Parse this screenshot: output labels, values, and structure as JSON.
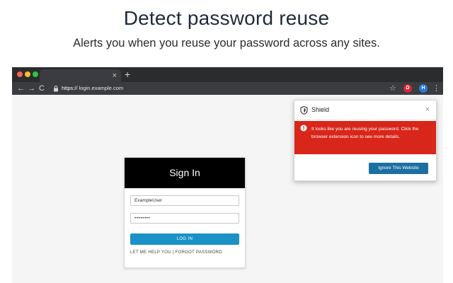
{
  "hero": {
    "title": "Detect password reuse",
    "subtitle": "Alerts you when you reuse your password across any sites."
  },
  "browser": {
    "tab_close": "×",
    "new_tab": "+",
    "nav": {
      "back": "←",
      "forward": "→",
      "reload": "C"
    },
    "url_protocol": "https://",
    "url_host": " login.example.com",
    "star": "☆",
    "ext_red_label": "D",
    "ext_blue_label": "H",
    "menu": "⋮"
  },
  "signin": {
    "heading": "Sign In",
    "username_value": "ExampleUser",
    "password_value": "••••••••",
    "login_label": "LOG IN",
    "help_text": "LET ME HELP YOU | FORGOT PASSWORD"
  },
  "popup": {
    "title": "Shield",
    "close": "×",
    "alert_message": "It looks like you are reusing your password. Click the browser extension icon to see more details.",
    "ignore_label": "Ignore This Website"
  },
  "colors": {
    "alert_red": "#d8261a",
    "primary_blue": "#1a92c7",
    "ignore_blue": "#1a6fa3",
    "titlebar": "#2b2c2e"
  }
}
